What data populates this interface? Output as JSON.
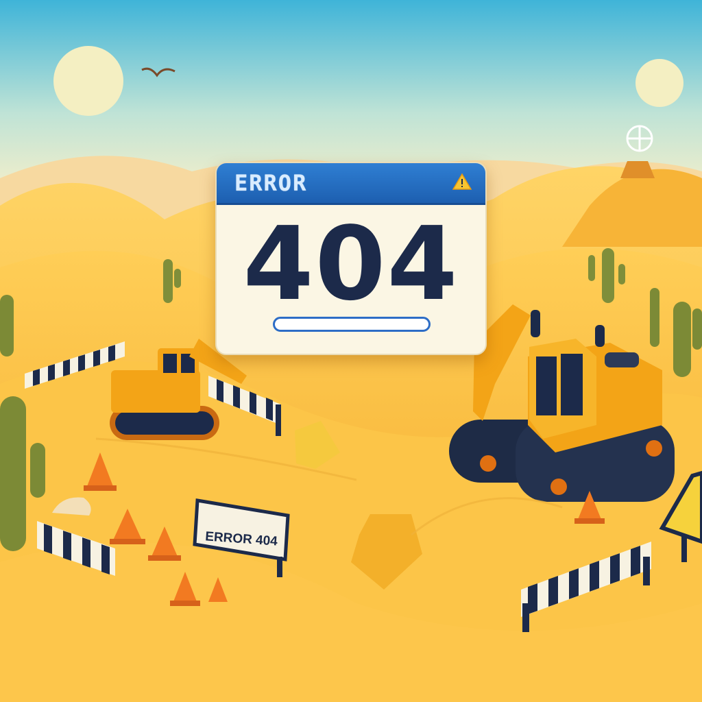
{
  "dialog": {
    "title": "ERROR",
    "code": "404",
    "progress_fraction": 0.0
  },
  "sign": {
    "label": "ERROR 404"
  },
  "icons": {
    "warning": "warning-triangle-icon"
  },
  "colors": {
    "sky_top": "#3fb4d8",
    "sky_bottom": "#fdf1c8",
    "sand": "#f6bf3c",
    "dialog_header": "#2368bd",
    "code_text": "#1c2a4a",
    "machine": "#f3a417"
  }
}
